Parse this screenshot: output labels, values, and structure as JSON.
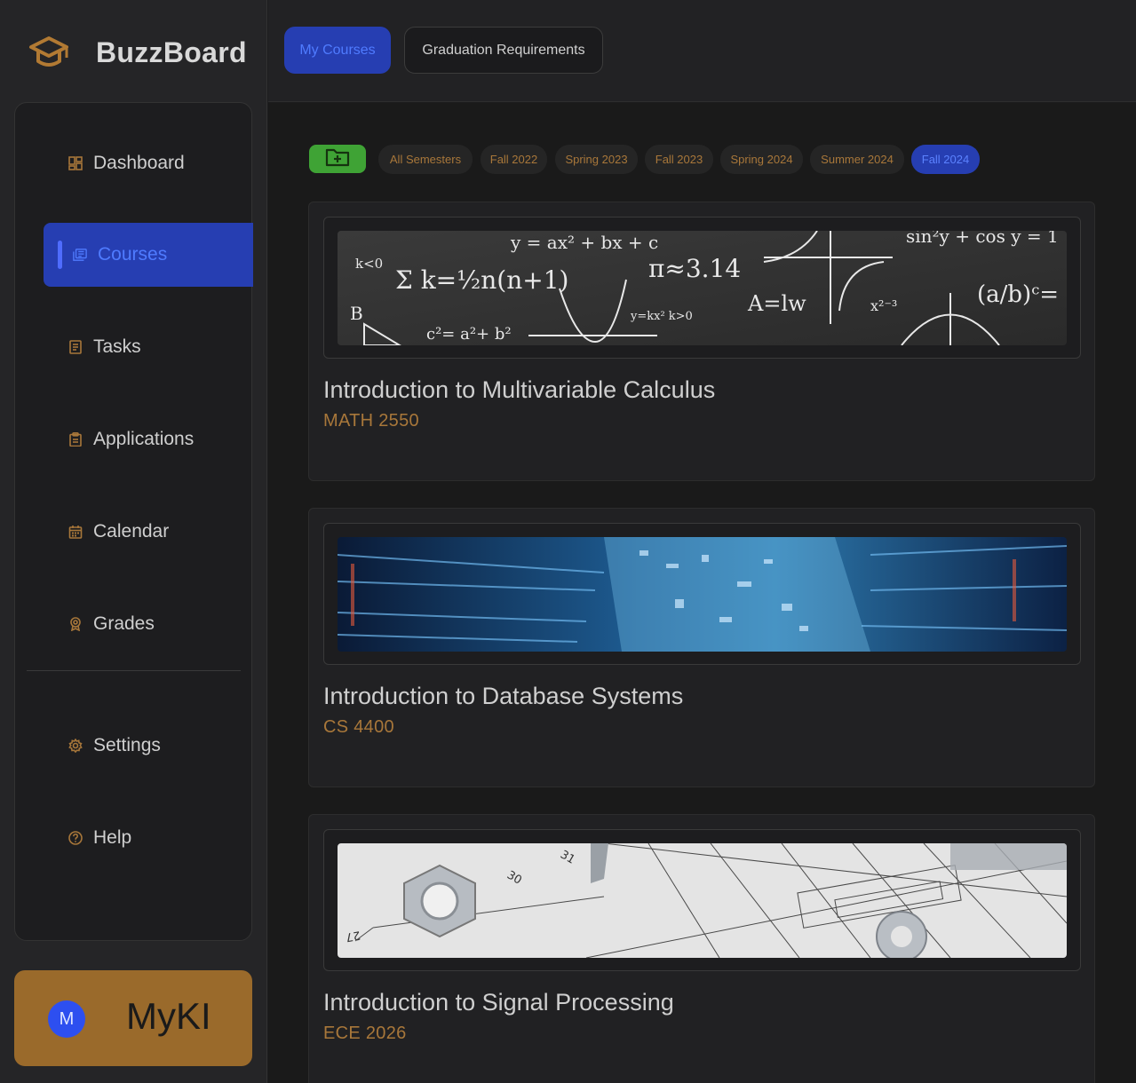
{
  "app": {
    "title": "BuzzBoard",
    "logo_icon": "graduation-cap-icon"
  },
  "sidebar": {
    "items": [
      {
        "label": "Dashboard",
        "icon": "dashboard-icon"
      },
      {
        "label": "Courses",
        "icon": "courses-icon",
        "active": true
      },
      {
        "label": "Tasks",
        "icon": "tasks-icon"
      },
      {
        "label": "Applications",
        "icon": "clipboard-icon"
      },
      {
        "label": "Calendar",
        "icon": "calendar-icon"
      },
      {
        "label": "Grades",
        "icon": "award-icon"
      }
    ],
    "bottom_items": [
      {
        "label": "Settings",
        "icon": "gear-icon"
      },
      {
        "label": "Help",
        "icon": "help-icon"
      }
    ],
    "assistant": {
      "avatar_initial": "M",
      "label": "MyKI"
    }
  },
  "topbar": {
    "tabs": [
      {
        "label": "My Courses",
        "active": true
      },
      {
        "label": "Graduation Requirements"
      }
    ]
  },
  "filters": {
    "add_icon": "folder-add-icon",
    "semesters": [
      "All Semesters",
      "Fall 2022",
      "Spring 2023",
      "Fall 2023",
      "Spring 2024",
      "Summer 2024",
      "Fall 2024"
    ],
    "selected": "Fall 2024"
  },
  "courses": [
    {
      "title": "Introduction to Multivariable Calculus",
      "code": "MATH 2550",
      "image": "math-chalkboard"
    },
    {
      "title": "Introduction to Database Systems",
      "code": "CS 4400",
      "image": "circuit-board"
    },
    {
      "title": "Introduction to Signal Processing",
      "code": "ECE 2026",
      "image": "engineering-blueprint"
    }
  ],
  "colors": {
    "accent_blue": "#263eb2",
    "accent_text_blue": "#4f7bff",
    "orange": "#a8773a",
    "myki_bg": "#9a6a2b",
    "add_green": "#3fa335"
  }
}
